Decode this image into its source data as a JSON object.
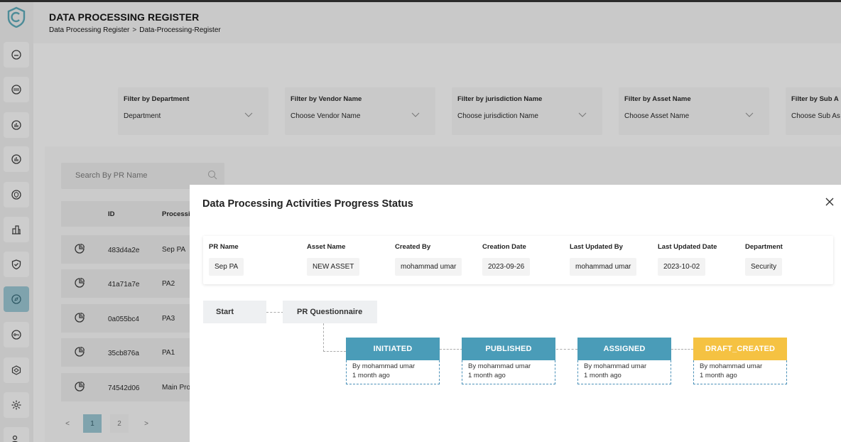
{
  "header": {
    "title": "DATA PROCESSING REGISTER",
    "breadcrumb": [
      "Data Processing Register",
      ">",
      "Data-Processing-Register"
    ]
  },
  "sidebar": {
    "items": [
      {
        "icon": "home-icon"
      },
      {
        "icon": "calendar-icon"
      },
      {
        "icon": "chart-icon"
      },
      {
        "icon": "chart-icon"
      },
      {
        "icon": "shield-icon"
      },
      {
        "icon": "building-icon"
      },
      {
        "icon": "shield-check-icon"
      },
      {
        "icon": "compass-icon",
        "active": true
      },
      {
        "icon": "key-icon"
      },
      {
        "icon": "globe-icon"
      },
      {
        "icon": "gear-icon"
      },
      {
        "icon": "users-icon"
      }
    ]
  },
  "filters": [
    {
      "label": "Filter by Department",
      "value": "Department"
    },
    {
      "label": "Filter by Vendor Name",
      "value": "Choose Vendor Name"
    },
    {
      "label": "Filter by jurisdiction Name",
      "value": "Choose jurisdiction Name"
    },
    {
      "label": "Filter by Asset Name",
      "value": "Choose Asset Name"
    },
    {
      "label": "Filter by Sub A",
      "value": "Choose Sub As"
    }
  ],
  "search": {
    "placeholder": "Search By PR Name"
  },
  "table": {
    "headers": [
      "ID",
      "Processi"
    ],
    "rows": [
      {
        "id": "483d4a2e",
        "name": "Sep PA"
      },
      {
        "id": "41a71a7e",
        "name": "PA2"
      },
      {
        "id": "0a055bc4",
        "name": "PA3"
      },
      {
        "id": "35cb876a",
        "name": "PA1"
      },
      {
        "id": "74542d06",
        "name": "Main Pro"
      }
    ]
  },
  "pagination": {
    "prev": "<",
    "pages": [
      "1",
      "2"
    ],
    "next": ">"
  },
  "modal": {
    "title": "Data Processing Activities Progress Status",
    "close": "×",
    "info": [
      {
        "label": "PR Name",
        "value": "Sep PA"
      },
      {
        "label": "Asset Name",
        "value": "NEW ASSET"
      },
      {
        "label": "Created By",
        "value": "mohammad umar"
      },
      {
        "label": "Creation Date",
        "value": "2023-09-26"
      },
      {
        "label": "Last Updated By",
        "value": "mohammad umar"
      },
      {
        "label": "Last Updated Date",
        "value": "2023-10-02"
      },
      {
        "label": "Department",
        "value": "Security"
      }
    ],
    "flow": {
      "start": "Start",
      "questionnaire": "PR Questionnaire",
      "stages": [
        {
          "status": "INITIATED",
          "by": "By mohammad umar",
          "when": "1 month ago",
          "color": "#4a9cb8"
        },
        {
          "status": "PUBLISHED",
          "by": "By mohammad umar",
          "when": "1 month ago",
          "color": "#4a9cb8"
        },
        {
          "status": "ASSIGNED",
          "by": "By mohammad umar",
          "when": "1 month ago",
          "color": "#4a9cb8"
        },
        {
          "status": "DRAFT_CREATED",
          "by": "By mohammad umar",
          "when": "1 month ago",
          "color": "#f5c242"
        }
      ]
    }
  }
}
